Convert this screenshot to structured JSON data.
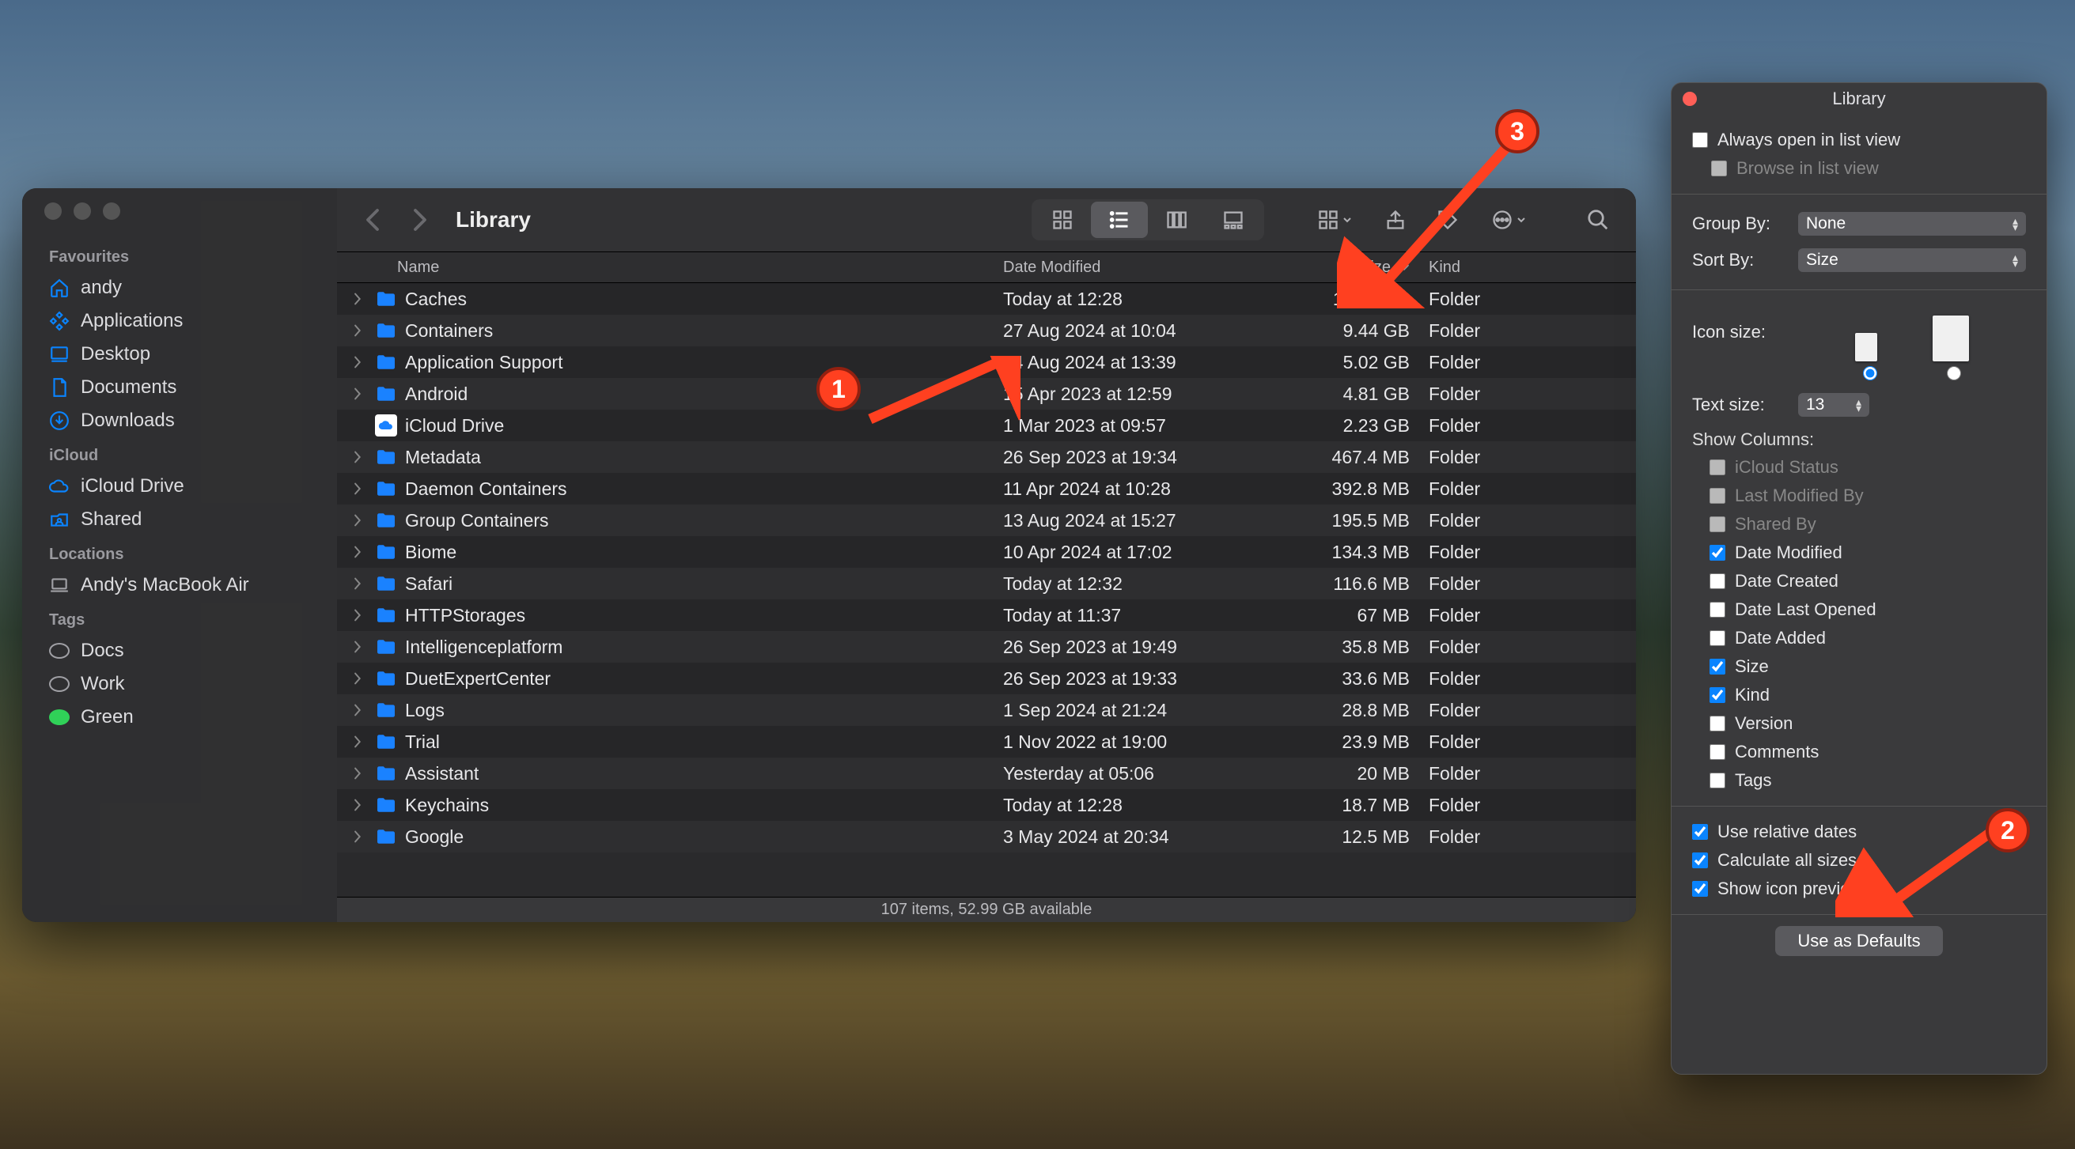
{
  "finder": {
    "title": "Library",
    "sidebar": {
      "headings": [
        "Favourites",
        "iCloud",
        "Locations",
        "Tags"
      ],
      "favourites": [
        {
          "label": "andy",
          "icon": "home"
        },
        {
          "label": "Applications",
          "icon": "apps"
        },
        {
          "label": "Desktop",
          "icon": "desktop"
        },
        {
          "label": "Documents",
          "icon": "doc"
        },
        {
          "label": "Downloads",
          "icon": "download"
        }
      ],
      "icloud": [
        {
          "label": "iCloud Drive",
          "icon": "cloud"
        },
        {
          "label": "Shared",
          "icon": "shared"
        }
      ],
      "locations": [
        {
          "label": "Andy's MacBook Air",
          "icon": "laptop"
        }
      ],
      "tags": [
        {
          "label": "Docs",
          "color": ""
        },
        {
          "label": "Work",
          "color": ""
        },
        {
          "label": "Green",
          "color": "green"
        }
      ]
    },
    "columns": {
      "name": "Name",
      "date": "Date Modified",
      "size": "Size",
      "kind": "Kind"
    },
    "sort_column": "size",
    "rows": [
      {
        "name": "Caches",
        "date": "Today at 12:28",
        "size": "13.69 GB",
        "kind": "Folder",
        "type": "folder"
      },
      {
        "name": "Containers",
        "date": "27 Aug 2024 at 10:04",
        "size": "9.44 GB",
        "kind": "Folder",
        "type": "folder"
      },
      {
        "name": "Application Support",
        "date": "24 Aug 2024 at 13:39",
        "size": "5.02 GB",
        "kind": "Folder",
        "type": "folder"
      },
      {
        "name": "Android",
        "date": "15 Apr 2023 at 12:59",
        "size": "4.81 GB",
        "kind": "Folder",
        "type": "folder"
      },
      {
        "name": "iCloud Drive",
        "date": "1 Mar 2023 at 09:57",
        "size": "2.23 GB",
        "kind": "Folder",
        "type": "cloud"
      },
      {
        "name": "Metadata",
        "date": "26 Sep 2023 at 19:34",
        "size": "467.4 MB",
        "kind": "Folder",
        "type": "folder"
      },
      {
        "name": "Daemon Containers",
        "date": "11 Apr 2024 at 10:28",
        "size": "392.8 MB",
        "kind": "Folder",
        "type": "folder"
      },
      {
        "name": "Group Containers",
        "date": "13 Aug 2024 at 15:27",
        "size": "195.5 MB",
        "kind": "Folder",
        "type": "folder"
      },
      {
        "name": "Biome",
        "date": "10 Apr 2024 at 17:02",
        "size": "134.3 MB",
        "kind": "Folder",
        "type": "folder"
      },
      {
        "name": "Safari",
        "date": "Today at 12:32",
        "size": "116.6 MB",
        "kind": "Folder",
        "type": "folder"
      },
      {
        "name": "HTTPStorages",
        "date": "Today at 11:37",
        "size": "67 MB",
        "kind": "Folder",
        "type": "folder"
      },
      {
        "name": "Intelligenceplatform",
        "date": "26 Sep 2023 at 19:49",
        "size": "35.8 MB",
        "kind": "Folder",
        "type": "folder"
      },
      {
        "name": "DuetExpertCenter",
        "date": "26 Sep 2023 at 19:33",
        "size": "33.6 MB",
        "kind": "Folder",
        "type": "folder"
      },
      {
        "name": "Logs",
        "date": "1 Sep 2024 at 21:24",
        "size": "28.8 MB",
        "kind": "Folder",
        "type": "folder"
      },
      {
        "name": "Trial",
        "date": "1 Nov 2022 at 19:00",
        "size": "23.9 MB",
        "kind": "Folder",
        "type": "folder"
      },
      {
        "name": "Assistant",
        "date": "Yesterday at 05:06",
        "size": "20 MB",
        "kind": "Folder",
        "type": "folder"
      },
      {
        "name": "Keychains",
        "date": "Today at 12:28",
        "size": "18.7 MB",
        "kind": "Folder",
        "type": "folder"
      },
      {
        "name": "Google",
        "date": "3 May 2024 at 20:34",
        "size": "12.5 MB",
        "kind": "Folder",
        "type": "folder"
      }
    ],
    "status": "107 items, 52.99 GB available"
  },
  "panel": {
    "title": "Library",
    "always_list": {
      "label": "Always open in list view",
      "checked": false
    },
    "browse_list": {
      "label": "Browse in list view",
      "checked": false
    },
    "group_by": {
      "label": "Group By:",
      "value": "None"
    },
    "sort_by": {
      "label": "Sort By:",
      "value": "Size"
    },
    "icon_size": {
      "label": "Icon size:",
      "selected": 0
    },
    "text_size": {
      "label": "Text size:",
      "value": "13"
    },
    "show_columns_label": "Show Columns:",
    "columns": [
      {
        "label": "iCloud Status",
        "checked": false,
        "disabled": true
      },
      {
        "label": "Last Modified By",
        "checked": false,
        "disabled": true
      },
      {
        "label": "Shared By",
        "checked": false,
        "disabled": true
      },
      {
        "label": "Date Modified",
        "checked": true
      },
      {
        "label": "Date Created",
        "checked": false
      },
      {
        "label": "Date Last Opened",
        "checked": false
      },
      {
        "label": "Date Added",
        "checked": false
      },
      {
        "label": "Size",
        "checked": true
      },
      {
        "label": "Kind",
        "checked": true
      },
      {
        "label": "Version",
        "checked": false
      },
      {
        "label": "Comments",
        "checked": false
      },
      {
        "label": "Tags",
        "checked": false
      }
    ],
    "bottom": [
      {
        "label": "Use relative dates",
        "checked": true
      },
      {
        "label": "Calculate all sizes",
        "checked": true
      },
      {
        "label": "Show icon preview",
        "checked": true
      }
    ],
    "defaults_button": "Use as Defaults"
  },
  "annotations": {
    "one": "1",
    "two": "2",
    "three": "3"
  }
}
